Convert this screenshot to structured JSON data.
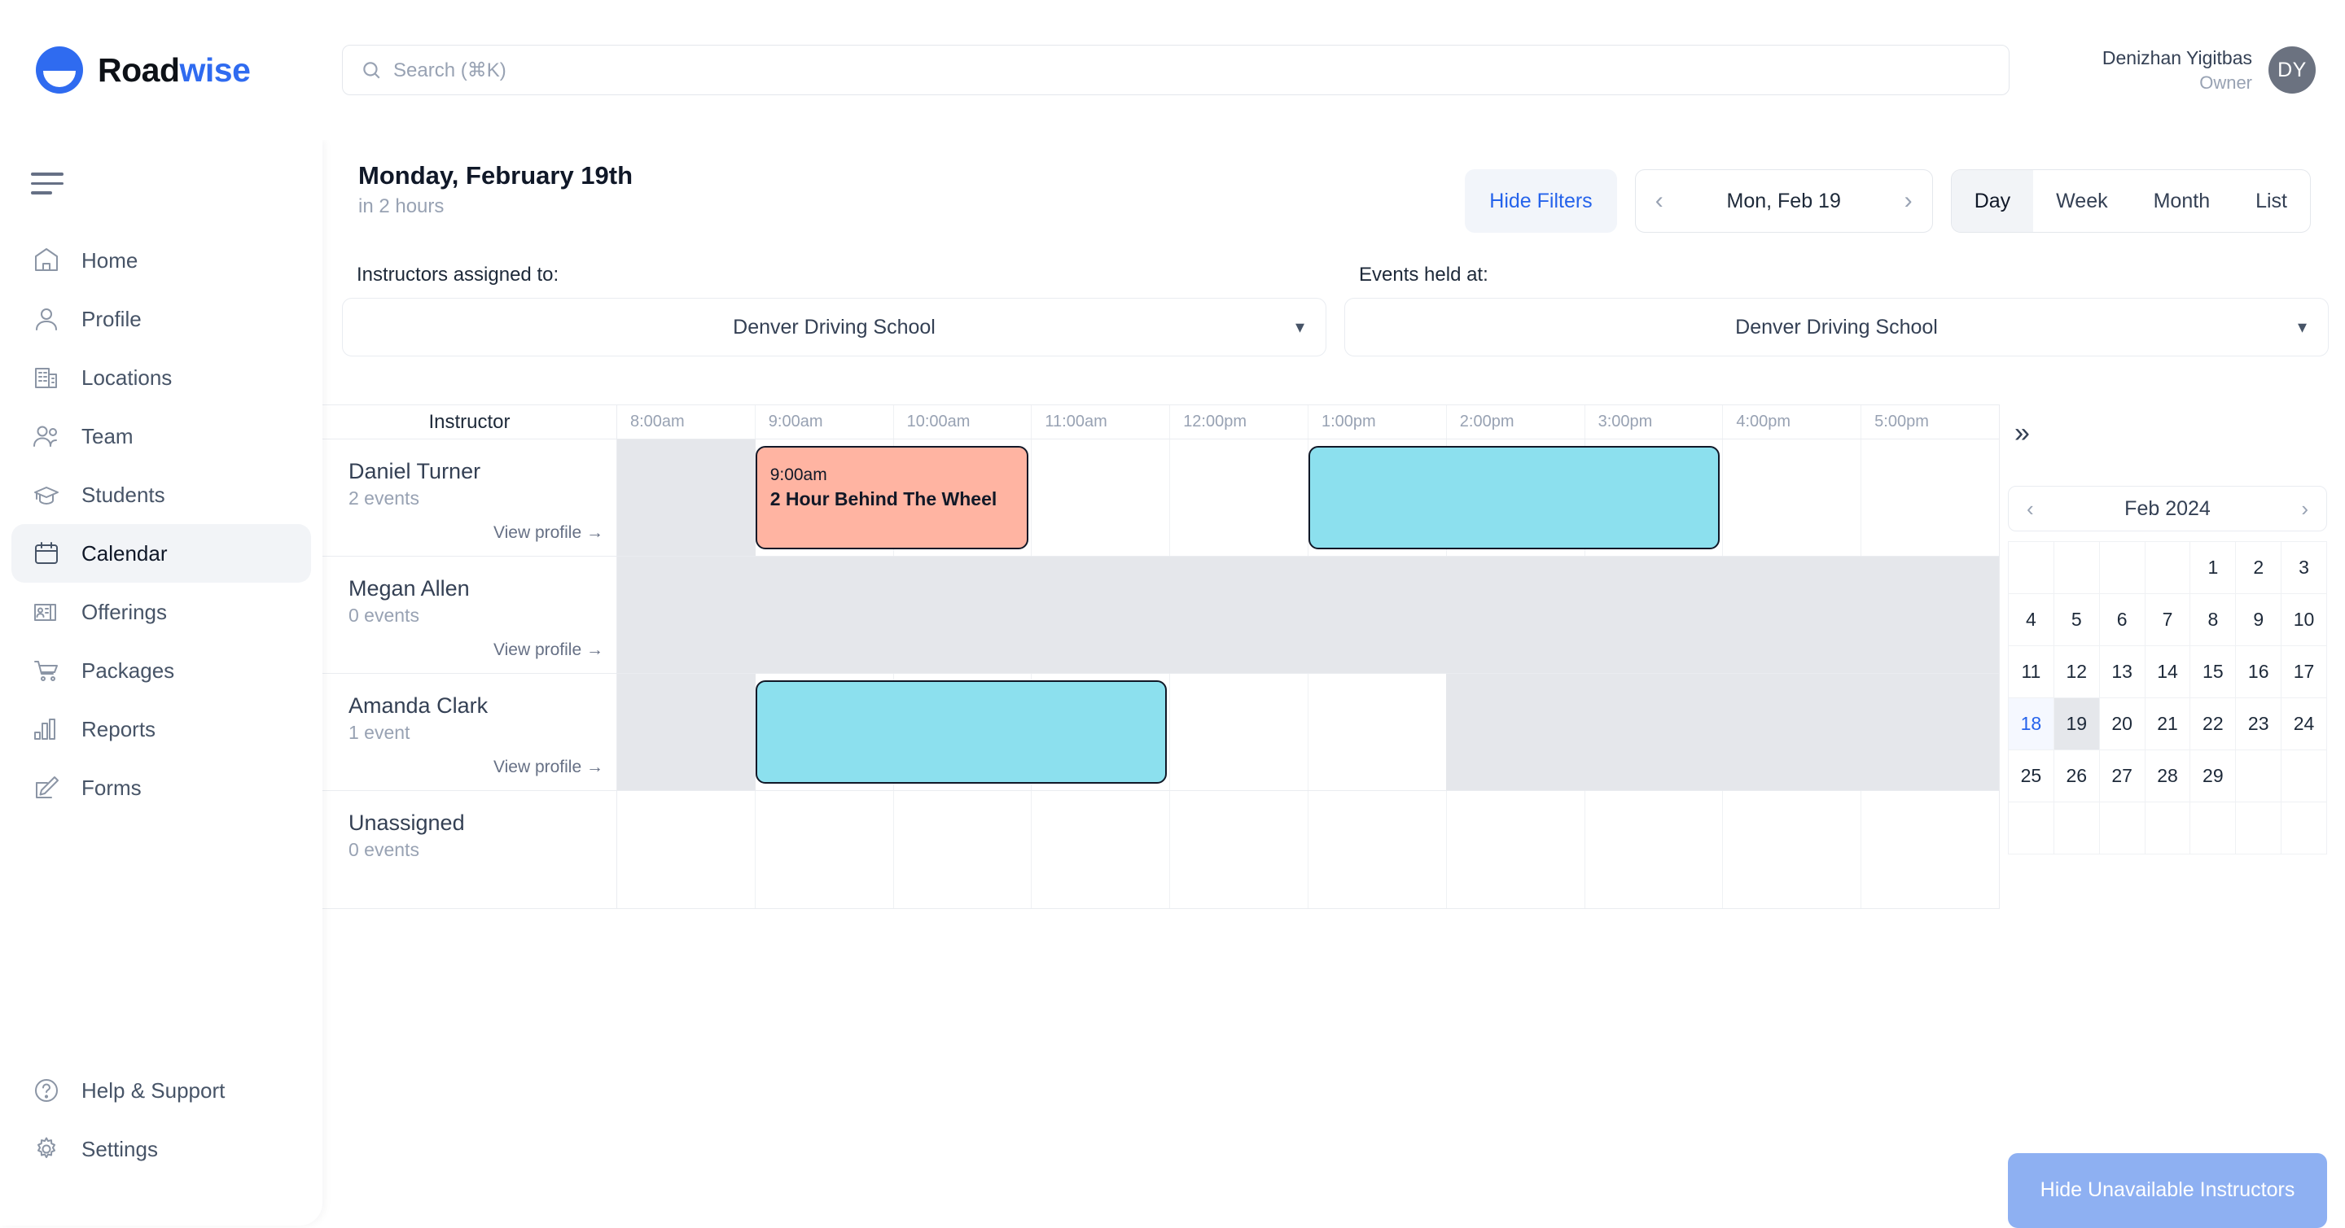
{
  "brand": {
    "name_dark": "Road",
    "name_accent": "wise"
  },
  "search": {
    "placeholder": "Search (⌘K)",
    "icon": "search-icon"
  },
  "user": {
    "name": "Denizhan Yigitbas",
    "role": "Owner",
    "initials": "DY"
  },
  "sidebar": {
    "items": [
      {
        "label": "Home",
        "icon": "home-icon"
      },
      {
        "label": "Profile",
        "icon": "user-icon"
      },
      {
        "label": "Locations",
        "icon": "building-icon"
      },
      {
        "label": "Team",
        "icon": "users-icon"
      },
      {
        "label": "Students",
        "icon": "graduation-cap-icon"
      },
      {
        "label": "Calendar",
        "icon": "calendar-icon"
      },
      {
        "label": "Offerings",
        "icon": "id-card-icon"
      },
      {
        "label": "Packages",
        "icon": "cart-icon"
      },
      {
        "label": "Reports",
        "icon": "bar-chart-icon"
      },
      {
        "label": "Forms",
        "icon": "pencil-square-icon"
      }
    ],
    "active_index": 5,
    "bottom_items": [
      {
        "label": "Help & Support",
        "icon": "question-circle-icon"
      },
      {
        "label": "Settings",
        "icon": "gear-icon"
      }
    ]
  },
  "page": {
    "title": "Monday, February 19th",
    "subtitle": "in 2 hours"
  },
  "toolbar": {
    "hide_filters_label": "Hide Filters",
    "prev_icon": "chevron-left-icon",
    "next_icon": "chevron-right-icon",
    "current_date_label": "Mon, Feb 19",
    "views": [
      {
        "label": "Day",
        "active": true
      },
      {
        "label": "Week",
        "active": false
      },
      {
        "label": "Month",
        "active": false
      },
      {
        "label": "List",
        "active": false
      }
    ]
  },
  "filters": [
    {
      "label": "Instructors assigned to:",
      "value": "Denver Driving School",
      "caret": "chevron-down-icon"
    },
    {
      "label": "Events held at:",
      "value": "Denver Driving School",
      "caret": "chevron-down-icon"
    }
  ],
  "calendar": {
    "instructor_col_header": "Instructor",
    "hours": [
      "8:00am",
      "9:00am",
      "10:00am",
      "11:00am",
      "12:00pm",
      "1:00pm",
      "2:00pm",
      "3:00pm",
      "4:00pm",
      "5:00pm"
    ],
    "view_profile_label": "View profile →",
    "rows": [
      {
        "name": "Daniel Turner",
        "events_count": "2 events",
        "has_profile_link": true,
        "unavailable": [
          {
            "start": 8,
            "end": 9
          }
        ],
        "events": [
          {
            "start": 9,
            "end": 11,
            "time": "9:00am",
            "title": "2 Hour Behind The Wheel",
            "color": "peach"
          },
          {
            "start": 13,
            "end": 16,
            "time": "",
            "title": "",
            "color": "cyan"
          }
        ]
      },
      {
        "name": "Megan Allen",
        "events_count": "0 events",
        "has_profile_link": true,
        "unavailable": [
          {
            "start": 8,
            "end": 18
          }
        ],
        "events": []
      },
      {
        "name": "Amanda Clark",
        "events_count": "1 event",
        "has_profile_link": true,
        "unavailable": [
          {
            "start": 8,
            "end": 9
          },
          {
            "start": 14,
            "end": 18
          }
        ],
        "events": [
          {
            "start": 9,
            "end": 12,
            "time": "",
            "title": "",
            "color": "cyan"
          }
        ]
      },
      {
        "name": "Unassigned",
        "events_count": "0 events",
        "has_profile_link": false,
        "unavailable": [],
        "events": []
      }
    ]
  },
  "right_panel": {
    "collapse_icon": "chevrons-right-icon",
    "mini_calendar": {
      "prev_icon": "chevron-left-icon",
      "next_icon": "chevron-right-icon",
      "month_label": "Feb 2024",
      "lead_blanks": 4,
      "days": [
        1,
        2,
        3,
        4,
        5,
        6,
        7,
        8,
        9,
        10,
        11,
        12,
        13,
        14,
        15,
        16,
        17,
        18,
        19,
        20,
        21,
        22,
        23,
        24,
        25,
        26,
        27,
        28,
        29
      ],
      "trail_blanks": 9,
      "today": 18,
      "selected": 19
    },
    "hide_unavailable_label": "Hide Unavailable Instructors"
  },
  "colors": {
    "accent": "#2f6bf0",
    "link": "#2563eb",
    "event_peach": "#ffb4a2",
    "event_cyan": "#8ce0ee",
    "unavailable": "#e5e7eb",
    "hide_unavail_btn": "#8eb0f2"
  }
}
